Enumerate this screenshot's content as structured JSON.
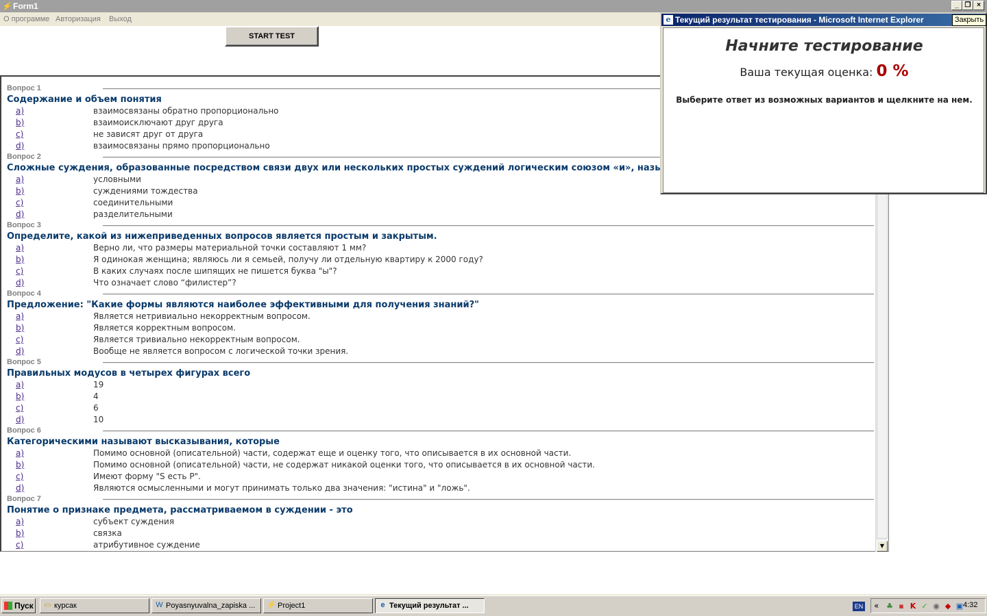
{
  "window": {
    "title": "Form1",
    "menu": [
      "О программе",
      "Авторизация",
      "Выход"
    ]
  },
  "start_button": "START TEST",
  "questions": [
    {
      "num": "Вопрос 1",
      "text": "Содержание и объем понятия",
      "answers": [
        {
          "letter": "a)",
          "text": "взаимосвязаны обратно пропорционально"
        },
        {
          "letter": "b)",
          "text": "взаимоисключают друг друга"
        },
        {
          "letter": "c)",
          "text": "не зависят друг от друга"
        },
        {
          "letter": "d)",
          "text": "взаимосвязаны прямо пропорционально"
        }
      ]
    },
    {
      "num": "Вопрос 2",
      "text": "Сложные суждения, образованные посредством связи двух или нескольких простых суждений логическим союзом «и», называются",
      "answers": [
        {
          "letter": "a)",
          "text": "условными"
        },
        {
          "letter": "b)",
          "text": "суждениями тождества"
        },
        {
          "letter": "c)",
          "text": "соединительными"
        },
        {
          "letter": "d)",
          "text": "разделительными"
        }
      ]
    },
    {
      "num": "Вопрос 3",
      "text": "Определите, какой из нижеприведенных вопросов является простым и закрытым.",
      "answers": [
        {
          "letter": "a)",
          "text": "Верно ли, что размеры материальной точки составляют 1 мм?"
        },
        {
          "letter": "b)",
          "text": "Я одинокая женщина; являюсь ли я семьей, получу ли отдельную квартиру к 2000 году?"
        },
        {
          "letter": "c)",
          "text": "В каких случаях после шипящих не пишется буква \"ы\"?"
        },
        {
          "letter": "d)",
          "text": "Что означает слово “филистер”?"
        }
      ]
    },
    {
      "num": "Вопрос 4",
      "text": "Предложение: \"Какие формы являются наиболее эффективными для получения знаний?\"",
      "answers": [
        {
          "letter": "a)",
          "text": "Является нетривиально некорректным вопросом."
        },
        {
          "letter": "b)",
          "text": "Является корректным вопросом."
        },
        {
          "letter": "c)",
          "text": "Является тривиально некорректным вопросом."
        },
        {
          "letter": "d)",
          "text": "Вообще не является вопросом с логической точки зрения."
        }
      ]
    },
    {
      "num": "Вопрос 5",
      "text": "Правильных модусов в четырех фигурах всего",
      "answers": [
        {
          "letter": "a)",
          "text": "19"
        },
        {
          "letter": "b)",
          "text": "4"
        },
        {
          "letter": "c)",
          "text": "6"
        },
        {
          "letter": "d)",
          "text": "10"
        }
      ]
    },
    {
      "num": "Вопрос 6",
      "text": "Категорическими называют высказывания, которые",
      "answers": [
        {
          "letter": "a)",
          "text": "Помимо основной (описательной) части, содержат еще и оценку того, что описывается в их основной части."
        },
        {
          "letter": "b)",
          "text": "Помимо основной (описательной) части, не содержат никакой оценки того, что описывается в их основной части."
        },
        {
          "letter": "c)",
          "text": "Имеют форму \"S есть P\"."
        },
        {
          "letter": "d)",
          "text": "Являются осмысленными и могут принимать только два значения: \"истина\" и \"ложь\"."
        }
      ]
    },
    {
      "num": "Вопрос 7",
      "text": "Понятие о признаке предмета, рассматриваемом в суждении - это",
      "answers": [
        {
          "letter": "a)",
          "text": "субъект суждения"
        },
        {
          "letter": "b)",
          "text": "связка"
        },
        {
          "letter": "c)",
          "text": "атрибутивное суждение"
        }
      ]
    }
  ],
  "popup": {
    "title": "Текущий результат тестирования - Microsoft Internet Explorer",
    "close_tooltip": "Закрыть",
    "heading": "Начните тестирование",
    "score_label": "Ваша текущая оценка:",
    "score_value": "0 %",
    "instruction": "Выберите ответ из возможных вариантов и щелкните на нем."
  },
  "taskbar": {
    "start": "Пуск",
    "tasks": [
      "курсак",
      "Poyasnyuvalna_zapiska ...",
      "Project1",
      "Текущий результат ..."
    ],
    "lang": "EN",
    "clock": "4:32"
  }
}
